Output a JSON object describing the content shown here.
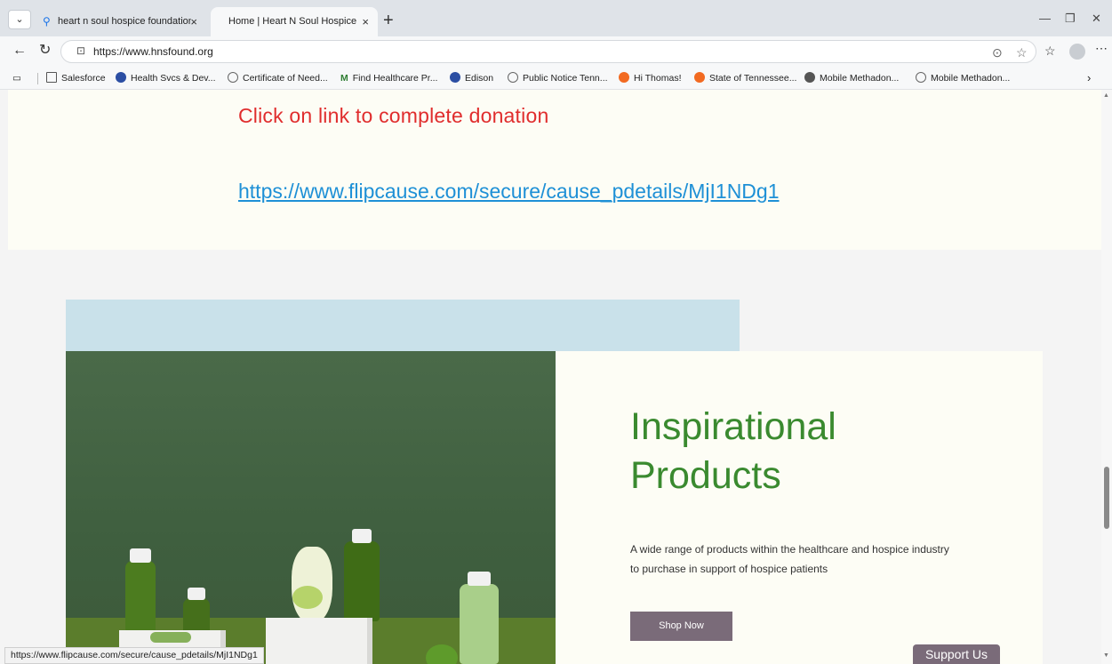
{
  "browser": {
    "tabs": [
      {
        "title": "heart n soul hospice foundation -",
        "close": "×"
      },
      {
        "title": "Home | Heart N Soul Hospice",
        "close": "×"
      }
    ],
    "new_tab": "+",
    "url": "https://www.hnsfound.org",
    "bookmarks": [
      {
        "label": "Salesforce",
        "color": "#888888"
      },
      {
        "label": "Health Svcs & Dev...",
        "color": "#2b4ea3"
      },
      {
        "label": "Certificate of Need...",
        "color": "#666666"
      },
      {
        "label": "Find Healthcare Pr...",
        "color": "#2e7d32"
      },
      {
        "label": "Edison",
        "color": "#2b4ea3"
      },
      {
        "label": "Public Notice Tenn...",
        "color": "#666666"
      },
      {
        "label": "Hi Thomas!",
        "color": "#f26a21"
      },
      {
        "label": "State of Tennessee...",
        "color": "#f26a21"
      },
      {
        "label": "Mobile Methadon...",
        "color": "#555555"
      },
      {
        "label": "Mobile Methadon...",
        "color": "#666666"
      }
    ],
    "bookmark_m_letter": "M",
    "status_url": "https://www.flipcause.com/secure/cause_pdetails/MjI1NDg1"
  },
  "page": {
    "donation_message": "Click on link to complete donation",
    "donation_link": "https://www.flipcause.com/secure/cause_pdetails/MjI1NDg1",
    "card_title": "Inspirational Products",
    "card_description": "A wide range of products within the healthcare and hospice industry to purchase in support of hospice patients",
    "shop_button": "Shop Now",
    "support_button": "Support Us"
  },
  "colors": {
    "accent_red": "#e02d2d",
    "link_blue": "#1e90d6",
    "title_green": "#3a8a2f",
    "button_mauve": "#7a6b79"
  }
}
